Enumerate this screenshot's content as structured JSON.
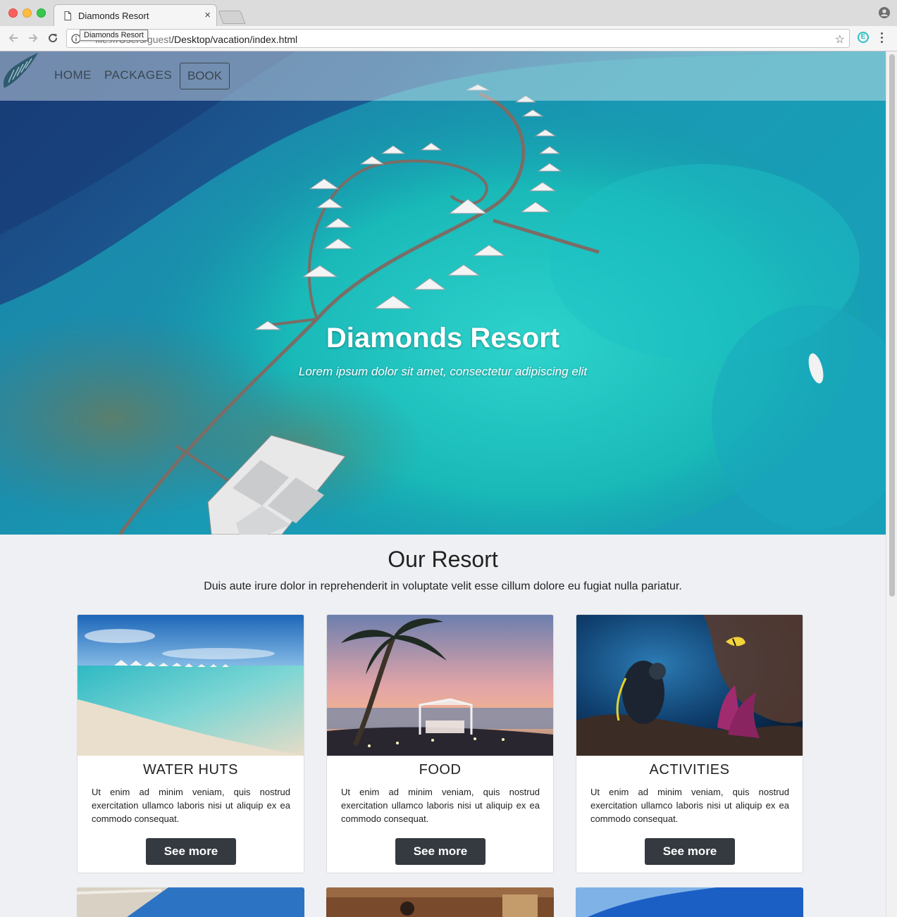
{
  "browser": {
    "tab_title": "Diamonds Resort",
    "tooltip": "Diamonds Resort",
    "url_hidden": "file:///Users/guest",
    "url": "/Desktop/vacation/index.html",
    "extension_letter": "E"
  },
  "nav": {
    "home": "HOME",
    "packages": "PACKAGES",
    "book": "BOOK"
  },
  "hero": {
    "title": "Diamonds Resort",
    "subtitle": "Lorem ipsum dolor sit amet, consectetur adipiscing elit"
  },
  "section": {
    "title": "Our Resort",
    "subtitle": "Duis aute irure dolor in reprehenderit in voluptate velit esse cillum dolore eu fugiat nulla pariatur."
  },
  "cards": [
    {
      "title": "WATER HUTS",
      "text": "Ut enim ad minim veniam, quis nostrud exercitation ullamco laboris nisi ut aliquip ex ea commodo consequat.",
      "button": "See more"
    },
    {
      "title": "FOOD",
      "text": "Ut enim ad minim veniam, quis nostrud exercitation ullamco laboris nisi ut aliquip ex ea commodo consequat.",
      "button": "See more"
    },
    {
      "title": "ACTIVITIES",
      "text": "Ut enim ad minim veniam, quis nostrud exercitation ullamco laboris nisi ut aliquip ex ea commodo consequat.",
      "button": "See more"
    }
  ],
  "colors": {
    "button_bg": "#343a40",
    "page_bg": "#eef0f3",
    "nav_text": "#3a4650"
  }
}
